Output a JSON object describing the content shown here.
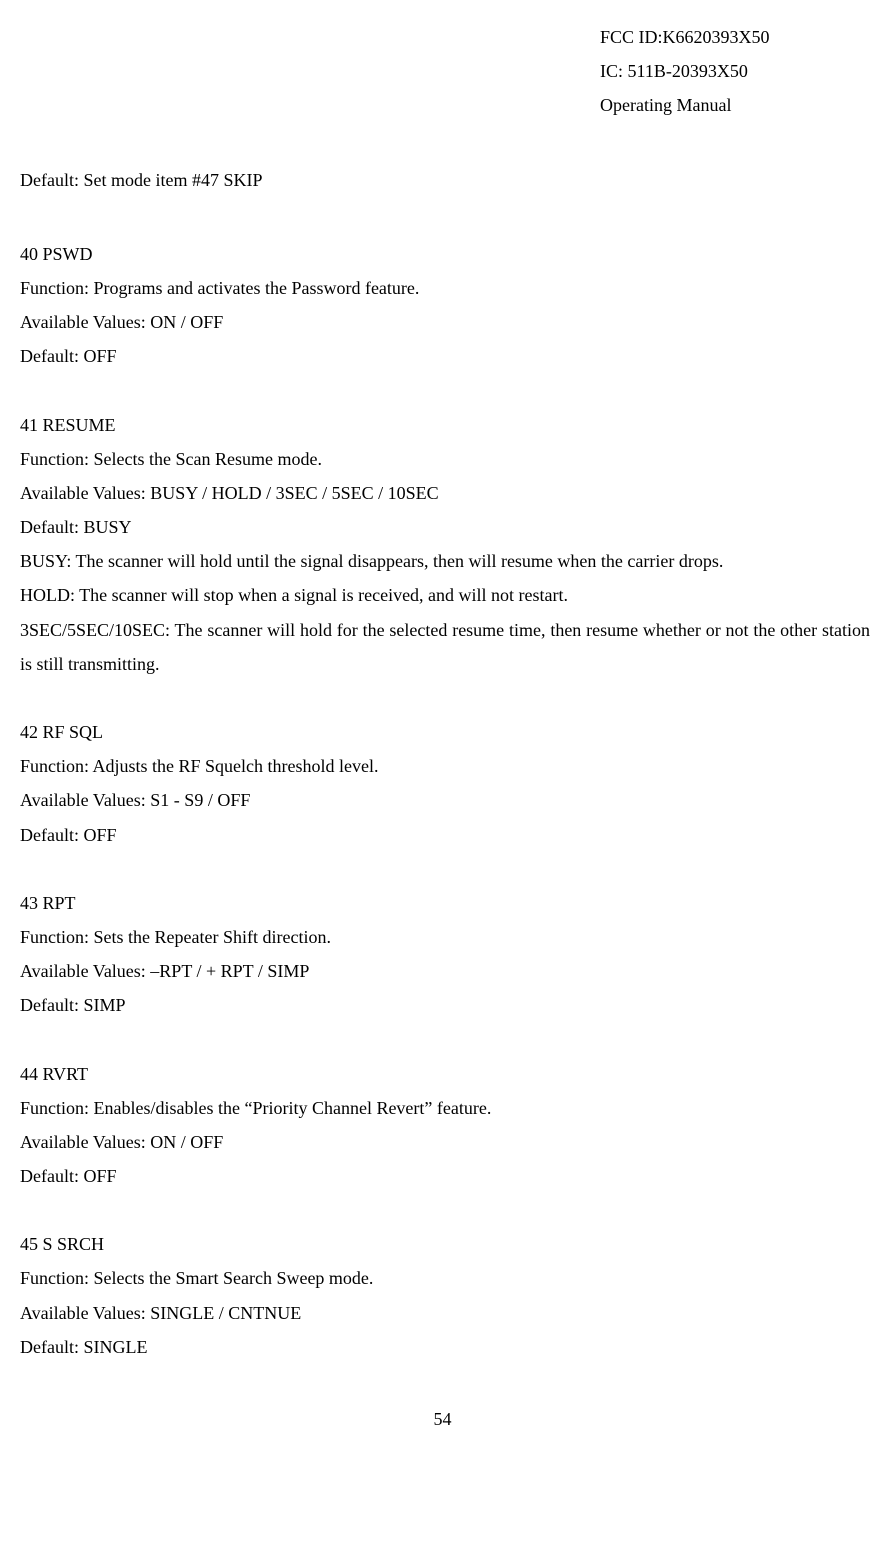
{
  "header": {
    "fcc": "FCC ID:K6620393X50",
    "ic": "IC: 511B-20393X50",
    "manual": "Operating Manual"
  },
  "defaultSkip": "Default:    Set mode item #47 SKIP",
  "items": [
    {
      "title": "40    PSWD",
      "function": "Function: Programs and activates the Password feature.",
      "available": "Available Values: ON / OFF",
      "default": "Default: OFF"
    },
    {
      "title": "41    RESUME",
      "function": "Function: Selects the Scan Resume mode.",
      "available": "Available Values: BUSY / HOLD / 3SEC / 5SEC / 10SEC",
      "default": "Default: BUSY",
      "extra": [
        "BUSY:    The scanner will hold until the signal disappears, then will resume when the carrier drops.",
        "HOLD:   The scanner will stop when a signal is received, and will not restart.",
        "3SEC/5SEC/10SEC: The scanner will hold for the selected resume time, then resume whether or not the other station is still transmitting."
      ]
    },
    {
      "title": "42    RF SQL",
      "function": "Function: Adjusts the RF Squelch threshold level.",
      "available": "Available Values: S1 - S9 / OFF",
      "default": "Default: OFF"
    },
    {
      "title": "43    RPT",
      "function": "Function: Sets the Repeater Shift direction.",
      "available": "Available Values: –RPT / + RPT / SIMP",
      "default": "Default: SIMP"
    },
    {
      "title": "44    RVRT",
      "function": "Function: Enables/disables the “Priority Channel Revert” feature.",
      "available": "Available Values: ON / OFF",
      "default": "Default: OFF"
    },
    {
      "title": "45    S SRCH",
      "function": "Function: Selects the Smart Search Sweep mode.",
      "available": "Available Values: SINGLE / CNTNUE",
      "default": "Default: SINGLE"
    }
  ],
  "pageNumber": "54"
}
